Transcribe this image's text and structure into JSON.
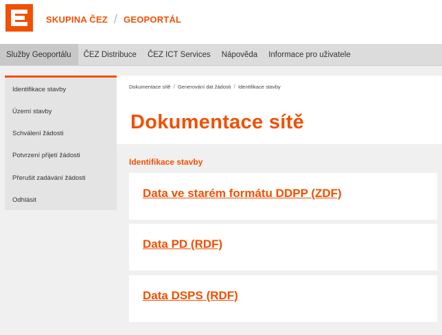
{
  "header": {
    "brand_left": "SKUPINA ČEZ",
    "brand_sep": "/",
    "brand_right": "GEOPORTÁL",
    "logo_icon": "cez-logo-icon",
    "accent_color": "#f24f00"
  },
  "nav": {
    "items": [
      {
        "label": "Služby Geoportálu"
      },
      {
        "label": "ČEZ Distribuce"
      },
      {
        "label": "ČEZ ICT Services"
      },
      {
        "label": "Nápověda"
      },
      {
        "label": "Informace pro uživatele"
      }
    ]
  },
  "sidebar": {
    "items": [
      {
        "label": "Identifikace stavby"
      },
      {
        "label": "Území stavby"
      },
      {
        "label": "Schválení žádosti"
      },
      {
        "label": "Potvrzení přijetí žádosti"
      },
      {
        "label": "Přerušit zadávání žádosti"
      },
      {
        "label": "Odhlásit"
      }
    ]
  },
  "breadcrumb": {
    "items": [
      {
        "label": "Dokumentace sítě"
      },
      {
        "label": "Generování dat žádosti"
      },
      {
        "label": "Identifikace stavby"
      }
    ],
    "separator": "/"
  },
  "main": {
    "title": "Dokumentace sítě",
    "section_label": "Identifikace stavby",
    "cards": [
      {
        "label": "Data ve starém formátu DDPP (ZDF)"
      },
      {
        "label": "Data PD (RDF)"
      },
      {
        "label": "Data DSPS (RDF)"
      }
    ]
  }
}
